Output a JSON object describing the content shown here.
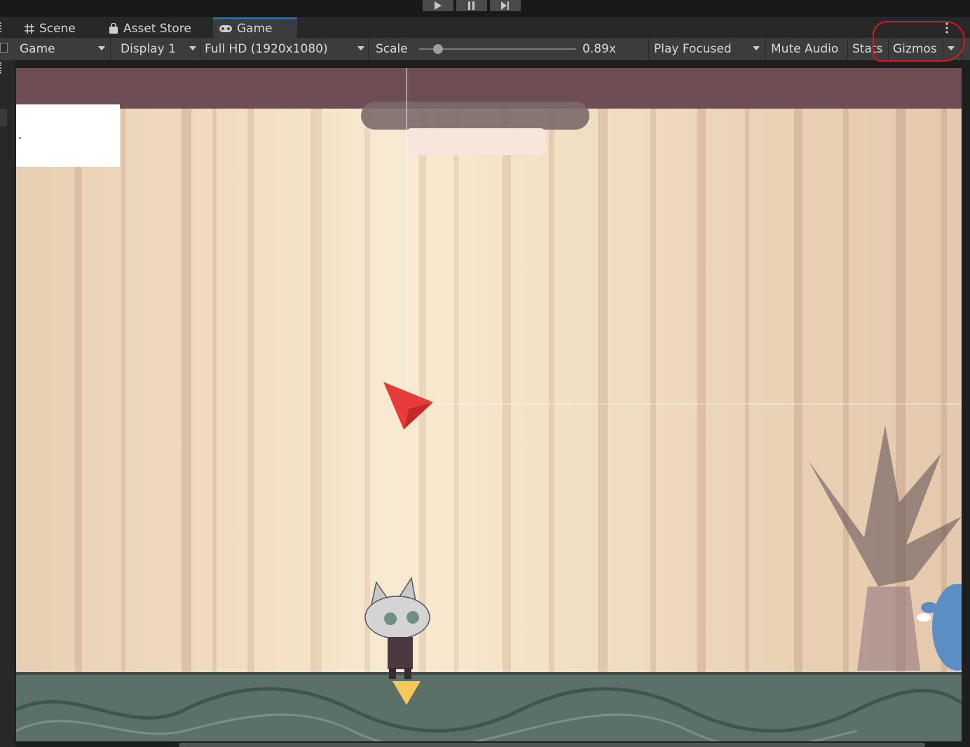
{
  "play_controls": {
    "play_icon": "play-icon",
    "pause_icon": "pause-icon",
    "step_icon": "step-icon"
  },
  "tabs": [
    {
      "label": "Scene",
      "icon": "grid-icon"
    },
    {
      "label": "Asset Store",
      "icon": "shopping-bag-icon"
    },
    {
      "label": "Game",
      "icon": "gamepad-icon",
      "active": true
    }
  ],
  "toolbar": {
    "view_mode": "Game",
    "display": "Display 1",
    "resolution": "Full HD (1920x1080)",
    "scale_label": "Scale",
    "scale_value": "0.89x",
    "play_mode": "Play Focused",
    "mute_audio": "Mute Audio",
    "stats": "Stats",
    "gizmos": "Gizmos"
  },
  "viewport": {
    "label_text": "."
  },
  "colors": {
    "accent_tab": "#3a79bb",
    "annotation_circle": "#e0141c",
    "cursor": "#e83a3a"
  }
}
